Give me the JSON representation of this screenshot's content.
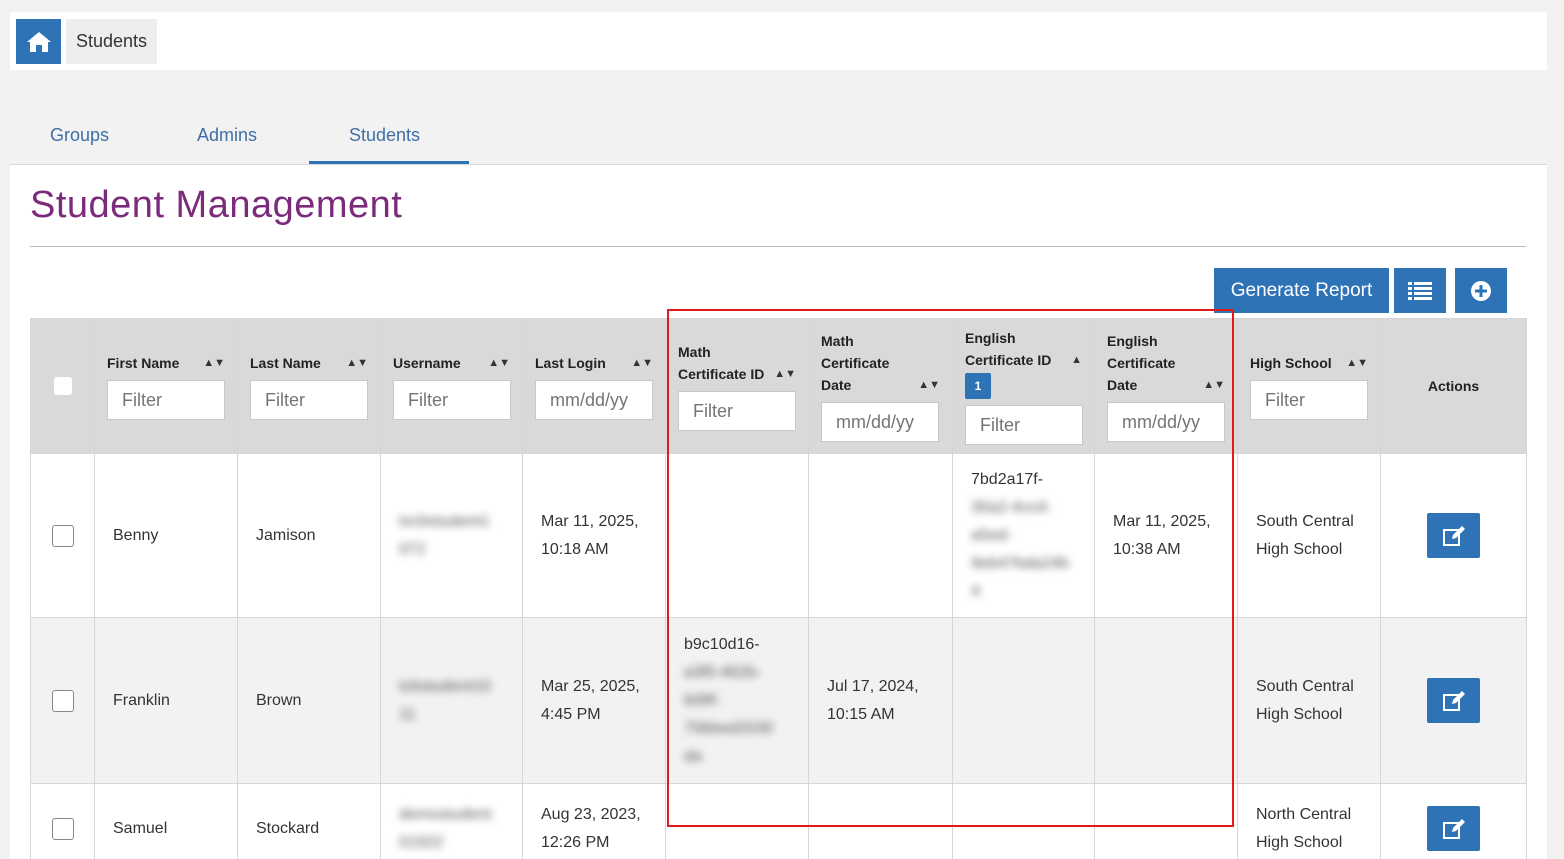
{
  "breadcrumb": {
    "home_icon": "home-icon",
    "current": "Students"
  },
  "tabs": [
    {
      "label": "Groups"
    },
    {
      "label": "Admins"
    },
    {
      "label": "Students",
      "active": true
    }
  ],
  "page_title": "Student Management",
  "toolbar": {
    "generate_report_label": "Generate Report",
    "list_icon": "list-icon",
    "add_icon": "plus-circle-icon"
  },
  "table": {
    "columns": [
      {
        "label": "First Name",
        "filter_placeholder": "Filter",
        "sort": "unsorted"
      },
      {
        "label": "Last Name",
        "filter_placeholder": "Filter",
        "sort": "unsorted"
      },
      {
        "label": "Username",
        "filter_placeholder": "Filter",
        "sort": "unsorted"
      },
      {
        "label": "Last Login",
        "filter_placeholder": "mm/dd/yy",
        "sort": "unsorted"
      },
      {
        "label": "Math Certificate ID",
        "filter_placeholder": "Filter",
        "sort": "unsorted"
      },
      {
        "label": "Math Certificate Date",
        "filter_placeholder": "mm/dd/yy",
        "sort": "unsorted"
      },
      {
        "label": "English Certificate ID",
        "filter_placeholder": "Filter",
        "sort": "ascending",
        "sort_order_badge": "1"
      },
      {
        "label": "English Certificate Date",
        "filter_placeholder": "mm/dd/yy",
        "sort": "unsorted"
      },
      {
        "label": "High School",
        "filter_placeholder": "Filter",
        "sort": "unsorted"
      },
      {
        "label": "Actions"
      }
    ],
    "rows": [
      {
        "first_name": "Benny",
        "last_name": "Jamison",
        "username": "txcbstudent1 072",
        "last_login_1": "Mar 11, 2025,",
        "last_login_2": "10:18 AM",
        "math_cert_id": "",
        "math_cert_date_1": "",
        "math_cert_date_2": "",
        "english_cert_id_visible": "7bd2a17f-",
        "english_cert_id_blurred": "30a2-4ccd-a5ed-9eb47bda24b 4",
        "english_cert_date_1": "Mar 11, 2025,",
        "english_cert_date_2": "10:38 AM",
        "high_school_1": "South Central",
        "high_school_2": "High School"
      },
      {
        "first_name": "Franklin",
        "last_name": "Brown",
        "username": "tcbstudent10 11",
        "last_login_1": "Mar 25, 2025,",
        "last_login_2": "4:45 PM",
        "math_cert_id_visible": "b9c10d16-",
        "math_cert_id_blurred": "a3f0-462b-b08f-70bbed2030 da",
        "math_cert_date_1": "Jul 17, 2024,",
        "math_cert_date_2": "10:15 AM",
        "english_cert_id_visible": "",
        "english_cert_date_1": "",
        "english_cert_date_2": "",
        "high_school_1": "South Central",
        "high_school_2": "High School"
      },
      {
        "first_name": "Samuel",
        "last_name": "Stockard",
        "username": "demostudent 01922",
        "last_login_1": "Aug 23, 2023,",
        "last_login_2": "12:26 PM",
        "high_school_1": "North Central",
        "high_school_2": "High School"
      }
    ]
  },
  "colors": {
    "primary": "#2f73b7",
    "title": "#7b2a7c",
    "highlight_box": "#e01b1b"
  }
}
